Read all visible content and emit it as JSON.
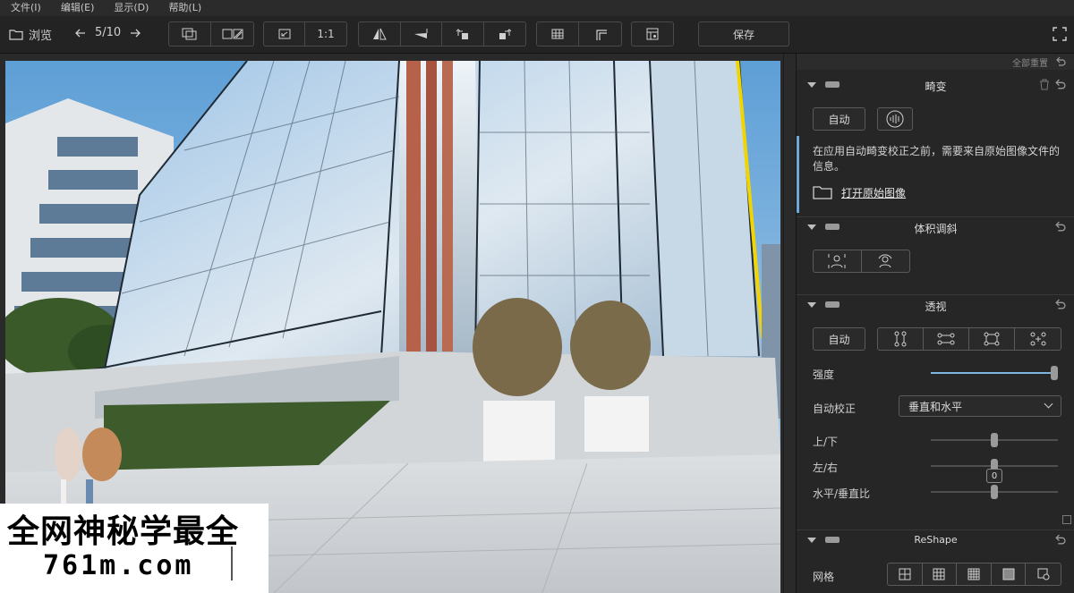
{
  "menu": {
    "items": [
      "文件(I)",
      "编辑(E)",
      "显示(D)",
      "帮助(L)"
    ]
  },
  "toolbar": {
    "browse_label": "浏览",
    "position": "5/10",
    "zoom_label": "1:1",
    "save_label": "保存"
  },
  "watermark": {
    "line1": "全网神秘学最全",
    "line2": "761m.com"
  },
  "panel": {
    "top_label": "全部重置",
    "sections": {
      "distortion": {
        "title": "畸变",
        "auto_label": "自动",
        "info": "在应用自动畸变校正之前，需要来自原始图像文件的信息。",
        "open_raw": "打开原始图像"
      },
      "volume": {
        "title": "体积调斜"
      },
      "perspective": {
        "title": "透视",
        "auto_label": "自动",
        "strength_label": "强度",
        "strength": 1.0,
        "autofix_label": "自动校正",
        "autofix_value": "垂直和水平",
        "updown_label": "上/下",
        "updown": 0,
        "leftright_label": "左/右",
        "leftright": 0,
        "leftright_value": "0",
        "ratio_label": "水平/垂直比",
        "ratio": 0
      },
      "reshape": {
        "title": "ReShape",
        "grid_label": "网格"
      }
    }
  },
  "colors": {
    "accent": "#6fa8d8",
    "panel_bg": "#262626",
    "guide_yellow": "#f2d500"
  }
}
